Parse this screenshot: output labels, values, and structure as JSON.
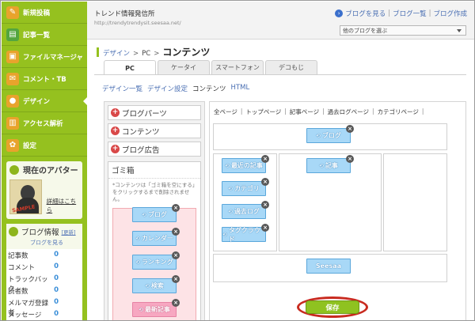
{
  "sidebar": {
    "items": [
      {
        "label": "新規投稿",
        "icon": "pencil-icon",
        "color": "#e8a32c"
      },
      {
        "label": "記事一覧",
        "icon": "document-icon",
        "color": "#53a53f"
      },
      {
        "label": "ファイルマネージャ",
        "icon": "file-icon",
        "color": "#e8a32c"
      },
      {
        "label": "コメント・TB",
        "icon": "comment-icon",
        "color": "#e8a32c"
      },
      {
        "label": "デザイン",
        "icon": "palette-icon",
        "color": "#e8a32c"
      },
      {
        "label": "アクセス解析",
        "icon": "chart-icon",
        "color": "#e8a32c"
      },
      {
        "label": "設定",
        "icon": "gear-icon",
        "color": "#e8a32c"
      }
    ],
    "avatar_box": {
      "title": "現在のアバター",
      "avatar_text": "SAMPLE",
      "link": "詳細はこちら"
    },
    "stats": {
      "title": "ブログ情報",
      "update_label": "[更新]",
      "view_link": "ブログを見る",
      "rows": [
        {
          "label": "記事数",
          "value": "0"
        },
        {
          "label": "コメント",
          "value": "0"
        },
        {
          "label": "トラックバック",
          "value": "0"
        },
        {
          "label": "読者数",
          "value": "0"
        },
        {
          "label": "メルマガ登録者",
          "value": "0"
        },
        {
          "label": "メッセージ",
          "value": "0"
        }
      ]
    }
  },
  "header": {
    "site_name": "トレンド情報発信所",
    "site_url": "http://trendytrendysit.seesaa.net/",
    "links": [
      "ブログを見る",
      "ブログ一覧",
      "ブログ作成"
    ],
    "blog_select": "他のブログを選ぶ"
  },
  "breadcrumb": {
    "root": "デザイン",
    "sub": "PC",
    "current": "コンテンツ"
  },
  "tabs": [
    "PC",
    "ケータイ",
    "スマートフォン",
    "デコもじ"
  ],
  "subnav": [
    "デザイン一覧",
    "デザイン設定",
    "コンテンツ",
    "HTML"
  ],
  "palette": {
    "items": [
      "ブログパーツ",
      "コンテンツ",
      "ブログ広告"
    ],
    "trash_title": "ゴミ箱",
    "trash_note": "*コンテンツは「ゴミ箱を空にする」をクリックするまで削除されません。",
    "trash_blocks": [
      "ブログ",
      "カレンダー",
      "ランキング",
      "検索",
      "最新記事"
    ]
  },
  "editor": {
    "page_links": [
      "全ページ",
      "トップページ",
      "記事ページ",
      "過去ログページ",
      "カテゴリページ"
    ],
    "header_block": "ブログ",
    "left_blocks": [
      "最近の記事",
      "カテゴリ",
      "過去ログ",
      "タグクラウド"
    ],
    "center_block": "記事",
    "footer_block": "Seesaa",
    "save_label": "保存"
  }
}
